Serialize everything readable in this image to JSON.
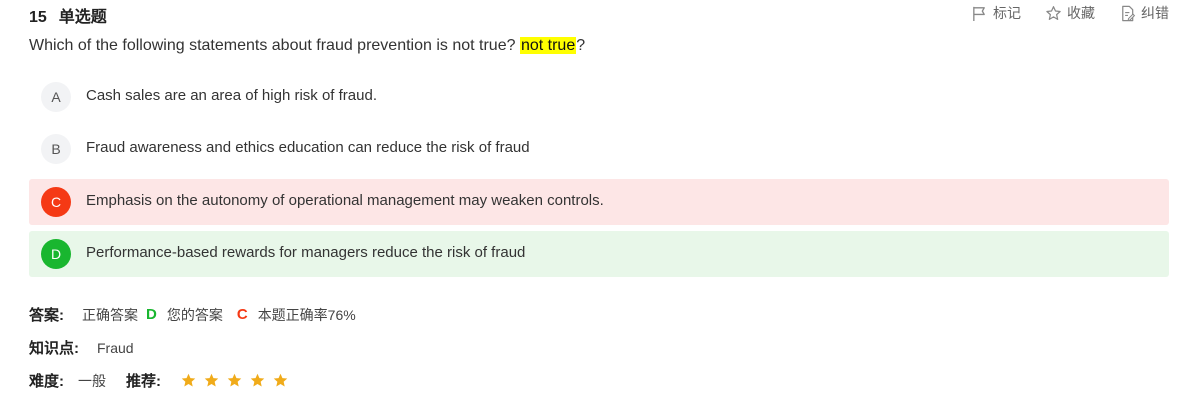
{
  "question": {
    "number": "15",
    "type": "单选题",
    "stem_text": "Which of the following statements about fraud prevention is not true?",
    "stem_highlight": "not true",
    "stem_suffix": "?"
  },
  "tools": {
    "mark_label": "标记",
    "favorite_label": "收藏",
    "report_label": "纠错"
  },
  "options": [
    {
      "letter": "A",
      "text": "Cash sales are an area of high risk of fraud.",
      "state": "normal"
    },
    {
      "letter": "B",
      "text": "Fraud awareness and ethics education can reduce the risk of fraud",
      "state": "normal"
    },
    {
      "letter": "C",
      "text": "Emphasis on the autonomy of operational management may weaken controls.",
      "state": "wrong-selected"
    },
    {
      "letter": "D",
      "text": "Performance-based rewards for managers reduce the risk of fraud",
      "state": "correct"
    }
  ],
  "answer": {
    "label": "答案:",
    "correct_label": "正确答案",
    "correct_value": "D",
    "yours_label": "您的答案",
    "yours_value": "C",
    "rate_text": "本题正确率76%"
  },
  "knowledge": {
    "label": "知识点:",
    "value": "Fraud"
  },
  "difficulty": {
    "label": "难度:",
    "value": "一般",
    "recommend_label": "推荐:",
    "stars": 5
  },
  "colors": {
    "wrong": "#f53915",
    "correct": "#19b62f",
    "wrong_bg": "#fde6e6",
    "correct_bg": "#e8f7e9",
    "highlight": "#ffff00",
    "star": "#f0ab1a"
  }
}
